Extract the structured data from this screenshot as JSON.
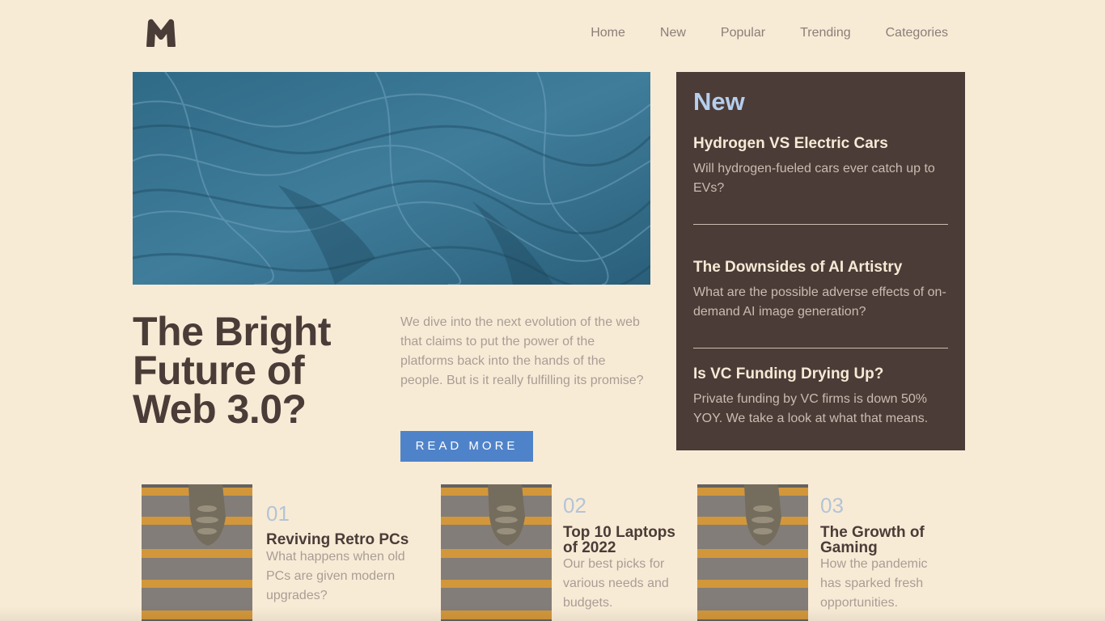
{
  "brand": {
    "logo_letter": "M",
    "logo_icon": "m-logo-icon"
  },
  "nav": {
    "items": [
      {
        "label": "Home"
      },
      {
        "label": "New"
      },
      {
        "label": "Popular"
      },
      {
        "label": "Trending"
      },
      {
        "label": "Categories"
      }
    ]
  },
  "hero": {
    "image": "blue-fabric-image",
    "title": "The Bright Future of Web 3.0?",
    "description": "We dive into the next evolution of the web that claims to put the power of the platforms back into the hands of the people. But is it really fulfilling its promise?",
    "button_label": "READ MORE"
  },
  "new_panel": {
    "heading": "New",
    "items": [
      {
        "title": "Hydrogen VS Electric Cars",
        "text": "Will hydrogen-fueled cars ever catch up to EVs?"
      },
      {
        "title": "The Downsides of AI Artistry",
        "text": "What are the possible adverse effects of on-demand AI image generation?"
      },
      {
        "title": "Is VC Funding Drying Up?",
        "text": "Private funding by VC firms is down 50% YOY. We take a look at what that means."
      }
    ]
  },
  "articles": [
    {
      "number": "01",
      "title": "Reviving Retro PCs",
      "text": "What happens when old PCs are given modern upgrades?",
      "image": "stairs-thumbnail-image"
    },
    {
      "number": "02",
      "title": "Top 10 Laptops of 2022",
      "text": "Our best picks for various needs and budgets.",
      "image": "stairs-thumbnail-image"
    },
    {
      "number": "03",
      "title": "The Growth of Gaming",
      "text": "How the pandemic has sparked fresh opportunities.",
      "image": "stairs-thumbnail-image"
    }
  ],
  "colors": {
    "background": "#f8ebd6",
    "dark_brown": "#4a3c37",
    "panel": "#4c3c37",
    "accent_blue": "#4f83c9",
    "light_blue": "#b5cfee"
  }
}
